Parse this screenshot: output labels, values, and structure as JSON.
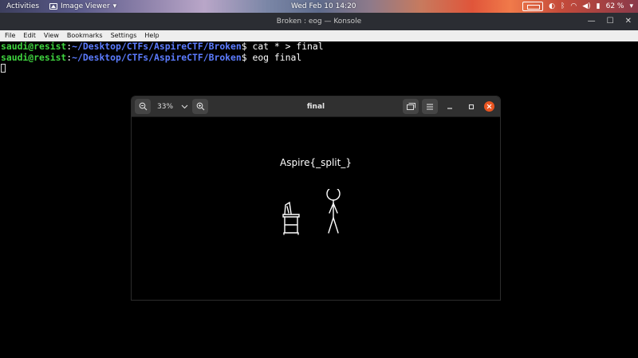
{
  "topbar": {
    "activities": "Activities",
    "app_menu": "Image Viewer",
    "app_menu_arrow": "▾",
    "clock": "Wed Feb 10  14:20",
    "battery": "62 %"
  },
  "konsole": {
    "title": "Broken : eog — Konsole",
    "menu": [
      "File",
      "Edit",
      "View",
      "Bookmarks",
      "Settings",
      "Help"
    ],
    "lines": [
      {
        "user": "saudi@resist",
        "sep": ":",
        "path": "~/Desktop/CTFs/AspireCTF/Broken",
        "sym": "$ ",
        "cmd": "cat * > final"
      },
      {
        "user": "saudi@resist",
        "sep": ":",
        "path": "~/Desktop/CTFs/AspireCTF/Broken",
        "sym": "$ ",
        "cmd": "eog final"
      }
    ]
  },
  "image_viewer": {
    "title": "final",
    "zoom": "33%",
    "image_text": "Aspire{_split_}"
  },
  "colors": {
    "prompt_user": "#3fd43f",
    "prompt_path": "#5c7cff",
    "close_button": "#e95420",
    "headerbar": "#303030"
  }
}
